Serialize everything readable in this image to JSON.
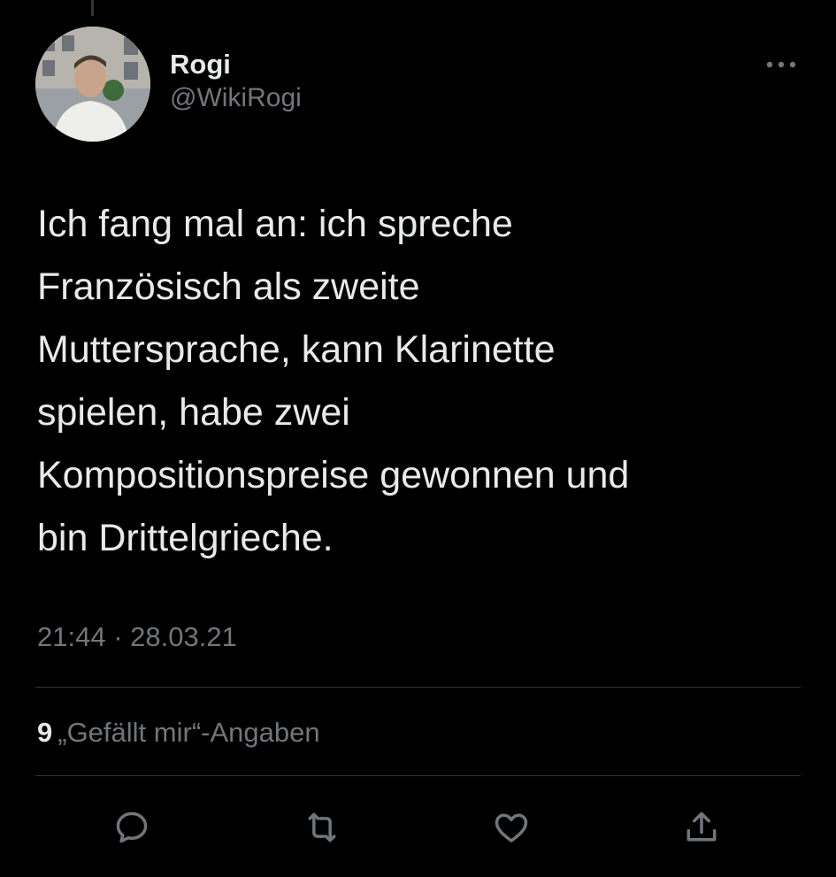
{
  "author": {
    "display_name": "Rogi",
    "handle": "@WikiRogi"
  },
  "tweet": {
    "text": "Ich fang mal an: ich spreche\nFranzösisch als zweite\nMuttersprache, kann Klarinette\nspielen, habe zwei\nKompositionspreise gewonnen und\nbin Drittelgrieche.",
    "time": "21:44",
    "separator": "·",
    "date": "28.03.21"
  },
  "engagement": {
    "likes_count": "9",
    "likes_label": "„Gefällt mir“-Angaben"
  },
  "actions": {
    "reply_icon": "speech-bubble-icon",
    "retweet_icon": "retweet-arrows-icon",
    "like_icon": "heart-icon",
    "share_icon": "share-upload-icon"
  },
  "colors": {
    "background": "#000000",
    "primary_text": "#e7e9ea",
    "secondary_text": "#71767b",
    "divider": "#2f3336"
  }
}
